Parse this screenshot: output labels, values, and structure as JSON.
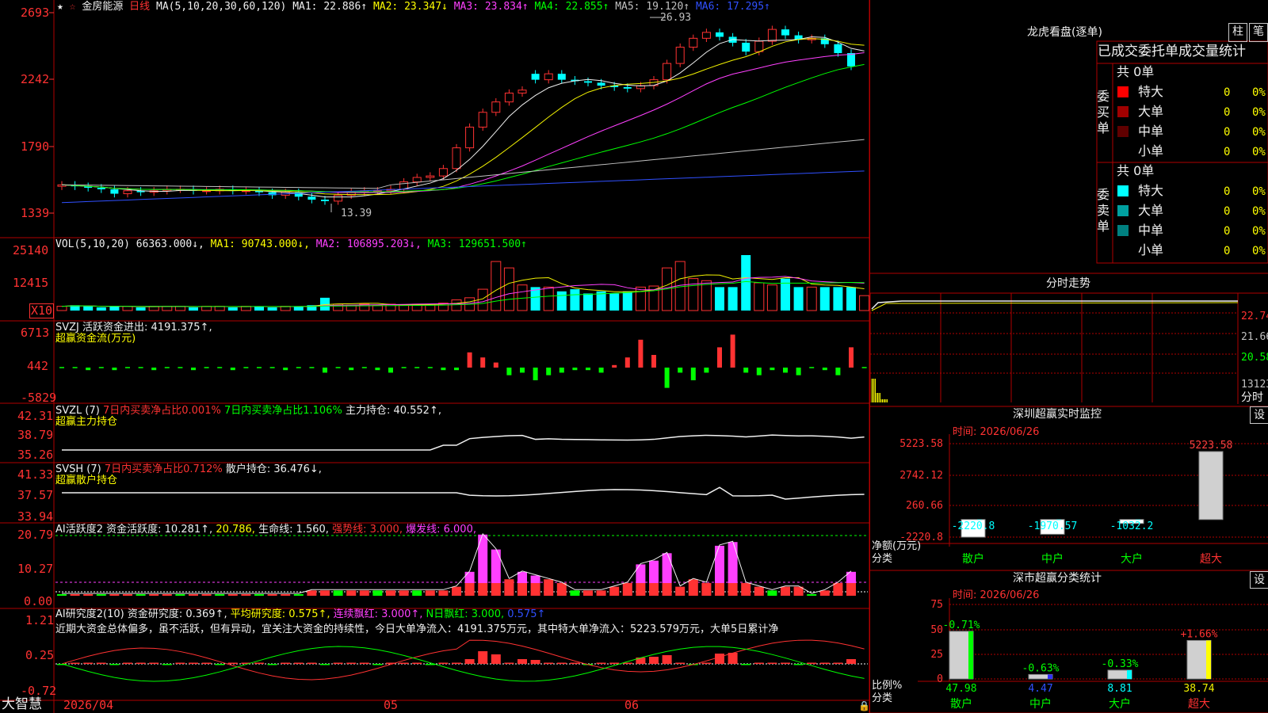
{
  "header": {
    "stock_name": "金房能源",
    "period": "日线",
    "ma_label": "MA(5,10,20,30,60,120)",
    "ma1": "MA1: 22.886↑",
    "ma2": "MA2: 23.347↓",
    "ma3": "MA3: 23.834↑",
    "ma4": "MA4: 22.855↑",
    "ma5": "MA5: 19.120↑",
    "ma6": "MA6: 17.295↑"
  },
  "price_axis": [
    "2693",
    "2242",
    "1790",
    "1339"
  ],
  "price_annotations": {
    "high": "26.93",
    "low": "13.39"
  },
  "vol": {
    "label": "VOL(5,10,20)",
    "value": "66363.000↓,",
    "ma1": "MA1: 90743.000↓,",
    "ma2": "MA2: 106895.203↓,",
    "ma3": "MA3: 129651.500↑",
    "axis": [
      "25140",
      "12415"
    ],
    "unit": "X10"
  },
  "svzj": {
    "line1": "SVZJ  活跃资金进出: 4191.375↑,",
    "line2": "超赢资金流(万元)",
    "axis": [
      "6713",
      "442",
      "-5829"
    ]
  },
  "svzl": {
    "prefix": "SVZL  (7)",
    "a": "7日内买卖净占比0.001%",
    "b": "7日内买卖净占比1.106%",
    "c": "主力持仓: 40.552↑,",
    "line2": "超赢主力持仓",
    "axis": [
      "42.31",
      "38.79",
      "35.26"
    ]
  },
  "svsh": {
    "prefix": "SVSH  (7)",
    "a": "7日内买卖净占比0.712%",
    "c": "散户持仓: 36.476↓,",
    "line2": "超赢散户持仓",
    "axis": [
      "41.33",
      "37.57",
      "33.94"
    ]
  },
  "ai_active": {
    "a": "AI活跃度2",
    "b": "资金活跃度: 10.281↑,",
    "c": "20.786,",
    "d": "生命线: 1.560,",
    "e": "强势线: 3.000,",
    "f": "爆发线: 6.000,",
    "axis": [
      "20.79",
      "10.27",
      "0.00"
    ]
  },
  "ai_research": {
    "a": "AI研究度2(10)",
    "b": "资金研究度: 0.369↑,",
    "c": "平均研究度: 0.575↑,",
    "d": "连续飘红: 3.000↑,",
    "e": "N日飘红: 3.000,",
    "f": "0.575↑",
    "summary": "近期大资金总体偏多，虽不活跃，但有异动，宜关注大资金的持续性，今日大单净流入：4191.375万元，其中特大单净流入：5223.579万元，大单5日累计净",
    "axis": [
      "1.21",
      "0.25",
      "-0.72"
    ]
  },
  "date_axis": [
    "2026/04",
    "05",
    "06"
  ],
  "brand": "大智慧",
  "right": {
    "dragon_title": "龙虎看盘(逐单)",
    "btn_zhu": "柱",
    "btn_bi": "笔",
    "stats_title": "已成交委托单成交量统计",
    "buy_side": "委买单",
    "sell_side": "委卖单",
    "buy_total": "共 0单",
    "sell_total": "共 0单",
    "buy_rows": [
      {
        "label": "特大",
        "count": "0",
        "pct": "0%",
        "color": "#ff0000"
      },
      {
        "label": "大单",
        "count": "0",
        "pct": "0%",
        "color": "#a00000"
      },
      {
        "label": "中单",
        "count": "0",
        "pct": "0%",
        "color": "#600000"
      },
      {
        "label": "小单",
        "count": "0",
        "pct": "0%",
        "color": ""
      }
    ],
    "sell_rows": [
      {
        "label": "特大",
        "count": "0",
        "pct": "0%",
        "color": "#00ffff"
      },
      {
        "label": "大单",
        "count": "0",
        "pct": "0%",
        "color": "#00a0a0"
      },
      {
        "label": "中单",
        "count": "0",
        "pct": "0%",
        "color": "#008080"
      },
      {
        "label": "小单",
        "count": "0",
        "pct": "0%",
        "color": ""
      }
    ],
    "intraday_title": "分时走势",
    "intraday_axis": [
      "22.74",
      "21.66",
      "20.58"
    ],
    "intraday_vol": "13123",
    "intraday_tag": "分时",
    "monitor_title": "深圳超赢实时监控",
    "monitor_btn": "设",
    "monitor_time": "时间: 2026/06/26",
    "monitor_axis": [
      "5223.58",
      "2742.12",
      "260.66",
      "-2220.8"
    ],
    "monitor_ylabel": "净额(万元)",
    "monitor_xlabel": "分类",
    "classify_title": "深市超赢分类统计",
    "classify_btn": "设",
    "classify_time": "时间: 2026/06/26",
    "classify_axis": [
      "75",
      "50",
      "25",
      "0"
    ],
    "classify_ylabel": "比例%",
    "classify_xlabel": "分类",
    "categories": [
      "散户",
      "中户",
      "大户",
      "超大"
    ]
  },
  "chart_data": [
    {
      "type": "bar",
      "title": "深圳超赢实时监控",
      "ylabel": "净额(万元)",
      "xlabel": "分类",
      "categories": [
        "散户",
        "中户",
        "大户",
        "超大"
      ],
      "values": [
        -2220.8,
        -1970.57,
        -1032.2,
        5223.58
      ],
      "labels": [
        "-2220.8",
        "-1970.57",
        "-1032.2",
        "5223.58"
      ],
      "ylim": [
        -2220.8,
        5223.58
      ]
    },
    {
      "type": "bar",
      "title": "深市超赢分类统计",
      "ylabel": "比例%",
      "xlabel": "分类",
      "categories": [
        "散户",
        "中户",
        "大户",
        "超大"
      ],
      "values": [
        47.98,
        4.47,
        8.81,
        38.74
      ],
      "labels": [
        "47.98",
        "4.47",
        "8.81",
        "38.74"
      ],
      "changes": [
        "-0.71%",
        "-0.63%",
        "-0.33%",
        "+1.66%"
      ],
      "ylim": [
        0,
        75
      ]
    }
  ]
}
